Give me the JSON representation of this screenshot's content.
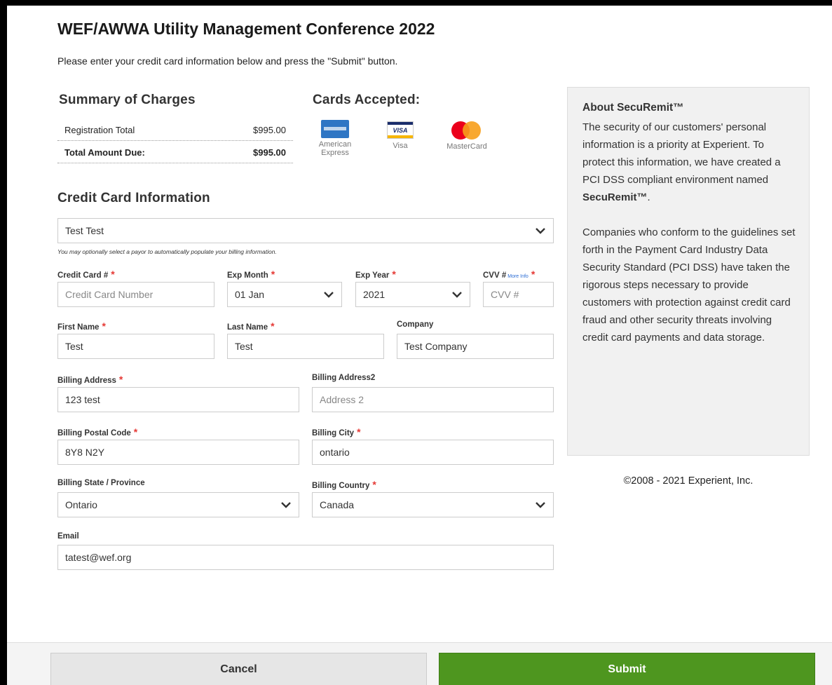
{
  "header": {
    "title": "WEF/AWWA Utility Management Conference 2022",
    "intro": "Please enter your credit card information below and press the \"Submit\" button."
  },
  "summary": {
    "heading": "Summary of Charges",
    "rows": [
      {
        "label": "Registration Total",
        "value": "$995.00"
      },
      {
        "label": "Total Amount Due:",
        "value": "$995.00"
      }
    ]
  },
  "cards_accepted": {
    "heading": "Cards Accepted:",
    "cards": [
      {
        "name": "American Express",
        "icon": "amex-icon"
      },
      {
        "name": "Visa",
        "icon": "visa-icon",
        "logo_text": "VISA"
      },
      {
        "name": "MasterCard",
        "icon": "mastercard-icon"
      }
    ]
  },
  "credit_card": {
    "heading": "Credit Card Information",
    "payor_select": "Test Test",
    "payor_hint": "You may optionally select a payor to automatically populate your billing information.",
    "required_mark": "*",
    "fields": {
      "card_number": {
        "label": "Credit Card #",
        "placeholder": "Credit Card Number",
        "value": ""
      },
      "exp_month": {
        "label": "Exp Month",
        "value": "01 Jan"
      },
      "exp_year": {
        "label": "Exp Year",
        "value": "2021"
      },
      "cvv": {
        "label": "CVV #",
        "more_info": "More Info",
        "placeholder": "CVV #",
        "value": ""
      },
      "first_name": {
        "label": "First Name",
        "value": "Test"
      },
      "last_name": {
        "label": "Last Name",
        "value": "Test"
      },
      "company": {
        "label": "Company",
        "value": "Test Company"
      },
      "address1": {
        "label": "Billing Address",
        "value": "123 test"
      },
      "address2": {
        "label": "Billing Address2",
        "placeholder": "Address 2",
        "value": ""
      },
      "postal": {
        "label": "Billing Postal Code",
        "value": "8Y8 N2Y"
      },
      "city": {
        "label": "Billing City",
        "value": "ontario"
      },
      "state": {
        "label": "Billing State / Province",
        "value": "Ontario"
      },
      "country": {
        "label": "Billing Country",
        "value": "Canada"
      },
      "email": {
        "label": "Email",
        "value": "tatest@wef.org"
      }
    }
  },
  "sidebar": {
    "heading": "About SecuRemit™",
    "para1_text": "The security of our customers' personal information is a priority at Experient. To protect this information, we have created a PCI DSS compliant environment named",
    "para1_bold": "SecuRemit™",
    "para1_end": ".",
    "para2": "Companies who conform to the guidelines set forth in the Payment Card Industry Data Security Standard (PCI DSS) have taken the rigorous steps necessary to provide customers with protection against credit card fraud and other security threats involving credit card payments and data storage."
  },
  "copyright": "©2008 - 2021 Experient, Inc.",
  "footer": {
    "cancel_label": "Cancel",
    "submit_label": "Submit"
  }
}
